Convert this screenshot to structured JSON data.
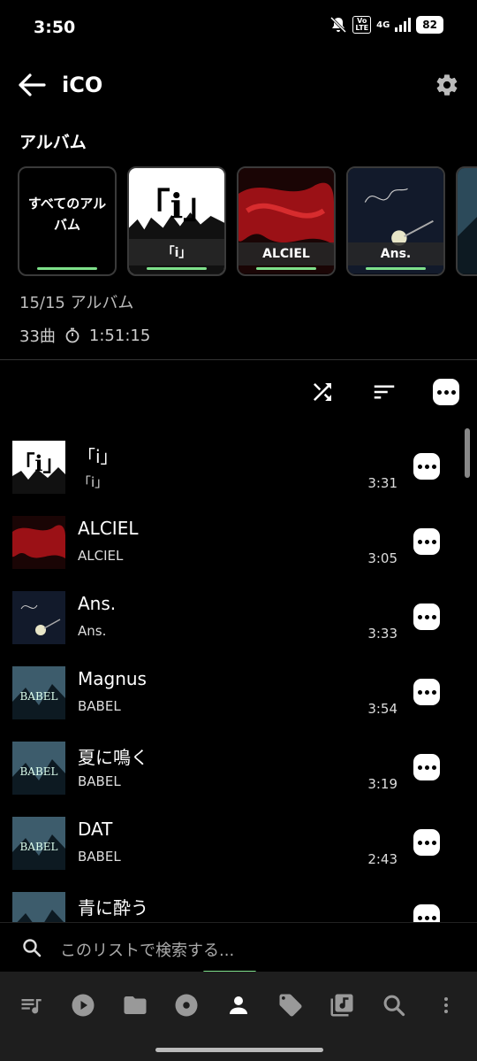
{
  "status": {
    "time": "3:50",
    "network": "4G",
    "volte": "Vo\nLTE",
    "battery": "82"
  },
  "header": {
    "title": "iCO"
  },
  "albums_section": {
    "title": "アルバム",
    "all_label": "すべてのアルバム",
    "cards": [
      {
        "label": "「i」",
        "art": "white"
      },
      {
        "label": "ALCIEL",
        "art": "red"
      },
      {
        "label": "Ans.",
        "art": "navy"
      }
    ],
    "count_text": "15/15 アルバム",
    "songs_count": "33曲",
    "total_duration": "1:51:15"
  },
  "songs": [
    {
      "title": "「i」",
      "album": "「i」",
      "duration": "3:31",
      "art": "white"
    },
    {
      "title": "ALCIEL",
      "album": "ALCIEL",
      "duration": "3:05",
      "art": "red"
    },
    {
      "title": "Ans.",
      "album": "Ans.",
      "duration": "3:33",
      "art": "navy"
    },
    {
      "title": "Magnus",
      "album": "BABEL",
      "duration": "3:54",
      "art": "babel"
    },
    {
      "title": "夏に鳴く",
      "album": "BABEL",
      "duration": "3:19",
      "art": "babel"
    },
    {
      "title": "DAT",
      "album": "BABEL",
      "duration": "2:43",
      "art": "babel"
    },
    {
      "title": "青に酔う",
      "album": "",
      "duration": "",
      "art": "babel"
    }
  ],
  "search": {
    "placeholder": "このリストで検索する..."
  },
  "colors": {
    "accent": "#7ee08a",
    "background": "#000000",
    "navbar": "#1e1e1e"
  }
}
